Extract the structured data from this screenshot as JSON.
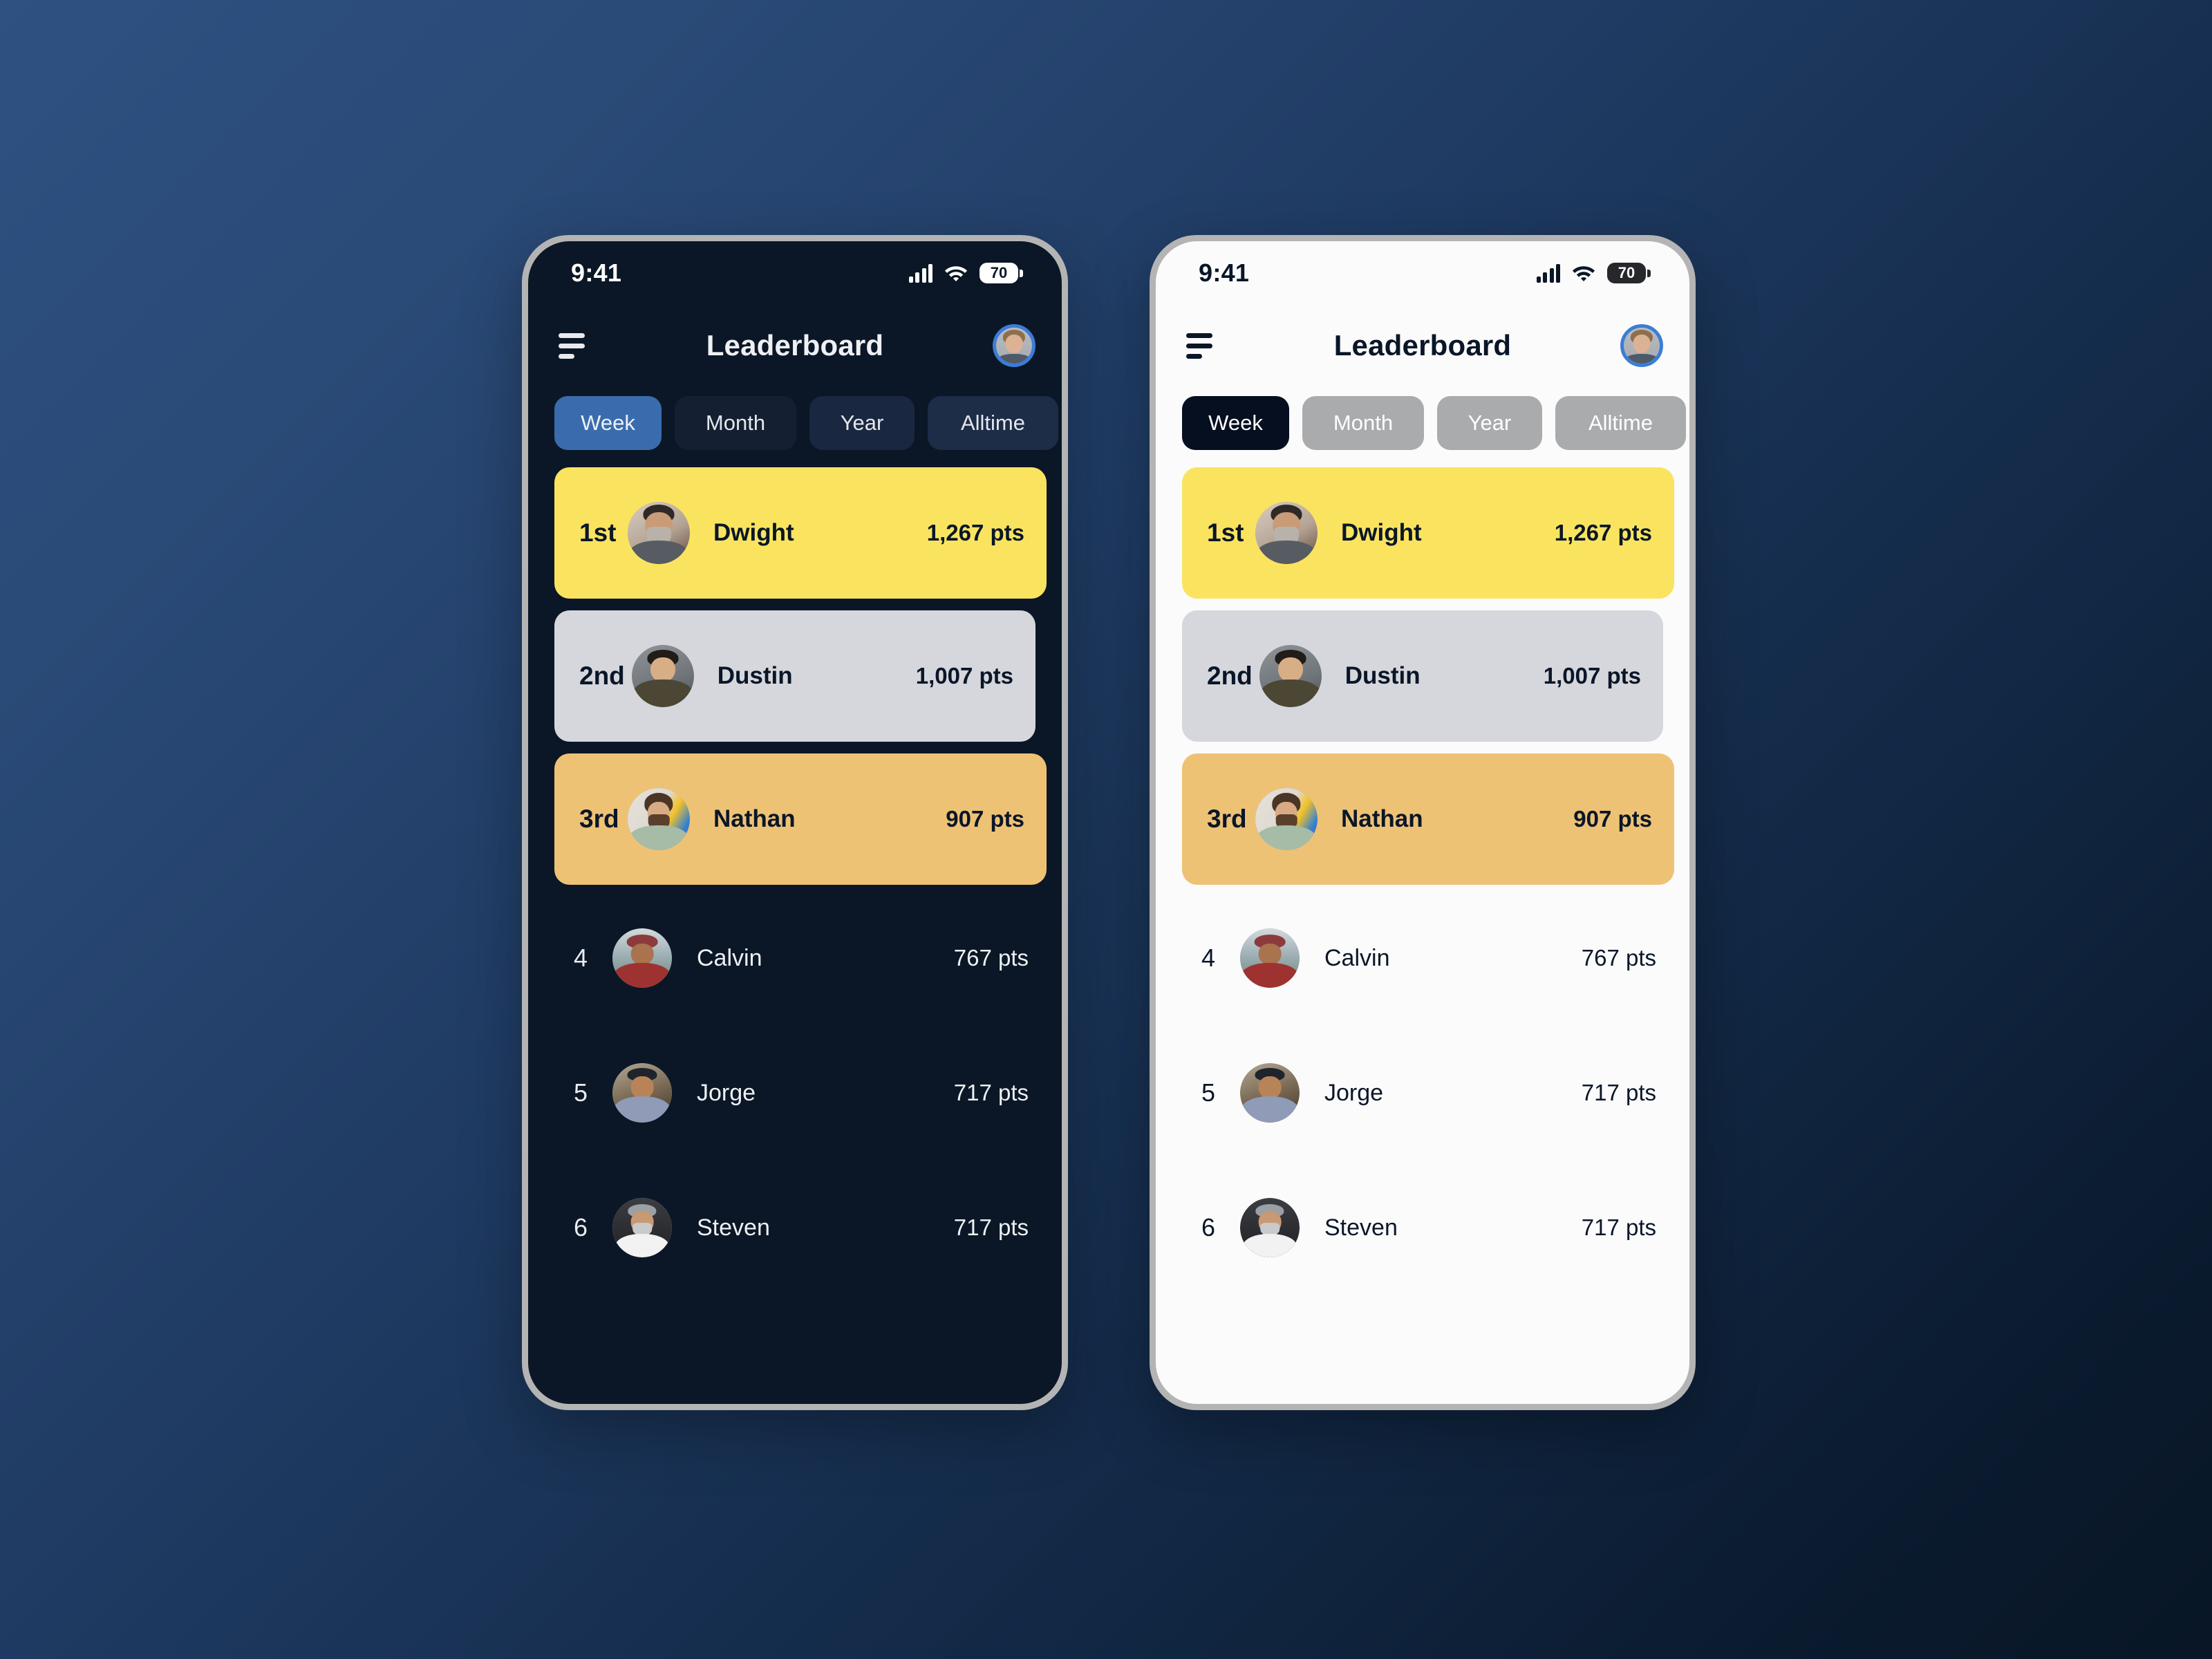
{
  "background": {
    "gradient_from": "#2e5182",
    "gradient_to": "#081625"
  },
  "phones": [
    {
      "id": "dark",
      "theme": "dark",
      "screen_bg": "#0b1726",
      "status_bar": {
        "time": "9:41",
        "signal_icon": "signal-bars-icon",
        "wifi_icon": "wifi-icon",
        "battery_icon": "battery-icon",
        "battery_level": "70"
      },
      "app_bar": {
        "menu_icon": "hamburger-menu-icon",
        "title": "Leaderboard",
        "avatar_icon": "user-avatar"
      },
      "tabs": [
        {
          "label": "Week",
          "active": true
        },
        {
          "label": "Month",
          "active": false
        },
        {
          "label": "Year",
          "active": false
        },
        {
          "label": "Alltime",
          "active": false
        }
      ]
    },
    {
      "id": "light",
      "theme": "light",
      "screen_bg": "#fbfbfb",
      "status_bar": {
        "time": "9:41",
        "signal_icon": "signal-bars-icon",
        "wifi_icon": "wifi-icon",
        "battery_icon": "battery-icon",
        "battery_level": "70"
      },
      "app_bar": {
        "menu_icon": "hamburger-menu-icon",
        "title": "Leaderboard",
        "avatar_icon": "user-avatar"
      },
      "tabs": [
        {
          "label": "Week",
          "active": true
        },
        {
          "label": "Month",
          "active": false
        },
        {
          "label": "Year",
          "active": false
        },
        {
          "label": "Alltime",
          "active": false
        }
      ]
    }
  ],
  "leaderboard": {
    "podium_colors": {
      "gold": "#fae45f",
      "silver": "#d5d7dc",
      "bronze": "#eec275"
    },
    "entries": [
      {
        "rank": "1st",
        "name": "Dwight",
        "points": "1,267 pts",
        "highlight": "gold"
      },
      {
        "rank": "2nd",
        "name": "Dustin",
        "points": "1,007 pts",
        "highlight": "silver"
      },
      {
        "rank": "3rd",
        "name": "Nathan",
        "points": "907 pts",
        "highlight": "bronze"
      },
      {
        "rank": "4",
        "name": "Calvin",
        "points": "767 pts",
        "highlight": "none"
      },
      {
        "rank": "5",
        "name": "Jorge",
        "points": "717 pts",
        "highlight": "none"
      },
      {
        "rank": "6",
        "name": "Steven",
        "points": "717 pts",
        "highlight": "none"
      }
    ]
  }
}
